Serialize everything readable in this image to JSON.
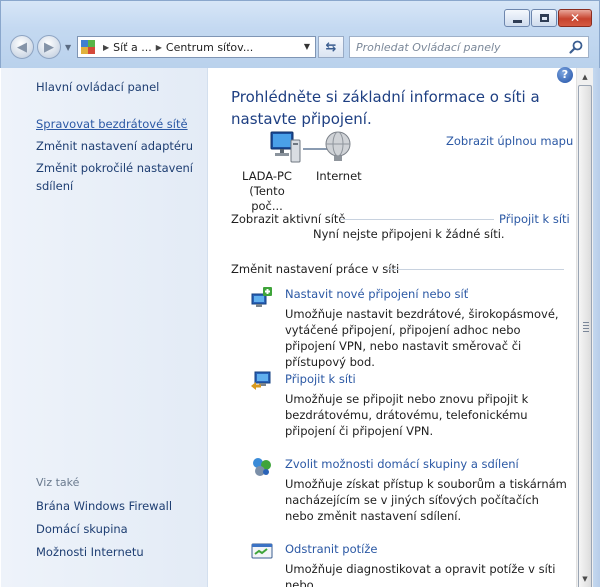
{
  "window": {
    "minimize_icon": "minimize-icon",
    "maximize_icon": "maximize-icon",
    "close_icon": "close-icon"
  },
  "nav": {
    "back_glyph": "◀",
    "forward_glyph": "▶",
    "drop_glyph": "▼"
  },
  "address": {
    "crumb_1": "Síť a ...",
    "crumb_2": "Centrum síťov...",
    "arrow_glyph": "▶",
    "drop_glyph": "▼"
  },
  "refresh_glyph": "⇆",
  "search": {
    "placeholder": "Prohledat Ovládací panely"
  },
  "sidebar": {
    "home": "Hlavní ovládací panel",
    "items": [
      {
        "label": "Spravovat bezdrátové sítě"
      },
      {
        "label": "Změnit nastavení adaptéru"
      },
      {
        "label": "Změnit pokročilé nastavení sdílení"
      }
    ],
    "see_also": "Viz také",
    "see_also_items": [
      {
        "label": "Brána Windows Firewall"
      },
      {
        "label": "Domácí skupina"
      },
      {
        "label": "Možnosti Internetu"
      }
    ]
  },
  "help_glyph": "?",
  "main": {
    "title": "Prohlédněte si základní informace o síti a nastavte připojení.",
    "full_map": "Zobrazit úplnou mapu",
    "computer_name": "LADA-PC",
    "computer_sub": "(Tento poč...",
    "internet": "Internet",
    "active_networks": "Zobrazit aktivní sítě",
    "connect_link": "Připojit k síti",
    "not_connected": "Nyní nejste připojeni k žádné síti.",
    "change_settings": "Změnit nastavení práce v síti",
    "tasks": [
      {
        "title": "Nastavit nové připojení nebo síť",
        "desc": "Umožňuje nastavit bezdrátové, širokopásmové, vytáčené připojení, připojení adhoc nebo připojení VPN, nebo nastavit směrovač či přístupový bod."
      },
      {
        "title": "Připojit k síti",
        "desc": "Umožňuje se připojit nebo znovu připojit k bezdrátovému, drátovému, telefonickému připojení či připojení VPN."
      },
      {
        "title": "Zvolit možnosti domácí skupiny a sdílení",
        "desc": "Umožňuje získat přístup k souborům a tiskárnám nacházejícím se v jiných síťových počítačích nebo změnit nastavení sdílení."
      },
      {
        "title": "Odstranit potíže",
        "desc": "Umožňuje diagnostikovat a opravit potíže v síti nebo"
      }
    ]
  },
  "scrollbar": {
    "up_glyph": "▲",
    "down_glyph": "▼"
  }
}
